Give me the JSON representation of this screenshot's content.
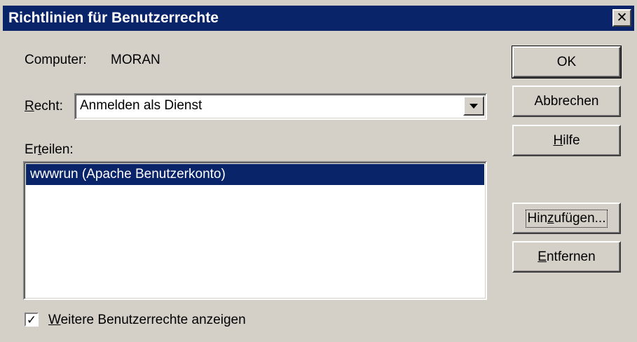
{
  "window": {
    "title": "Richtlinien für Benutzerrechte",
    "close_glyph": "✕"
  },
  "computer": {
    "label": "Computer:",
    "value": "MORAN"
  },
  "recht": {
    "label_underlined": "R",
    "label_rest": "echt:",
    "selected": "Anmelden als Dienst"
  },
  "erteilen": {
    "label_pre": "Er",
    "label_underlined": "t",
    "label_rest": "eilen:",
    "items": [
      "wwwrun (Apache Benutzerkonto)"
    ]
  },
  "checkbox": {
    "checked": true,
    "label_underlined": "W",
    "label_rest": "eitere Benutzerrechte anzeigen"
  },
  "buttons": {
    "ok": "OK",
    "abbrechen": "Abbrechen",
    "hilfe_underlined": "H",
    "hilfe_rest": "ilfe",
    "hinzu_pre": "Hin",
    "hinzu_underlined": "z",
    "hinzu_rest": "ufügen...",
    "entfernen_underlined": "E",
    "entfernen_rest": "ntfernen"
  },
  "colors": {
    "title_bar": "#0a246a",
    "dialog_bg": "#d4d0c8",
    "selection": "#0a246a"
  }
}
